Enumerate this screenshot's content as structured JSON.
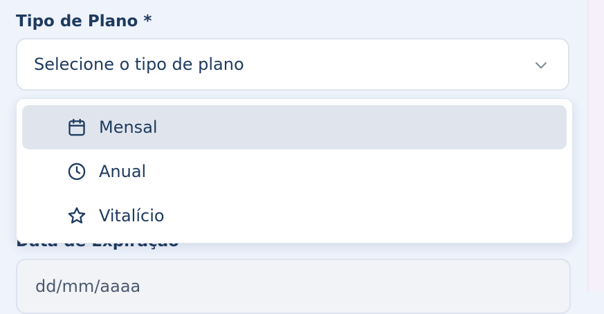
{
  "form": {
    "plan_type": {
      "label": "Tipo de Plano *",
      "placeholder": "Selecione o tipo de plano",
      "options": [
        {
          "label": "Mensal",
          "icon": "calendar-icon",
          "highlighted": true
        },
        {
          "label": "Anual",
          "icon": "clock-icon",
          "highlighted": false
        },
        {
          "label": "Vitalício",
          "icon": "star-icon",
          "highlighted": false
        }
      ]
    },
    "expiration": {
      "label": "Data de Expiração",
      "placeholder": "dd/mm/aaaa"
    }
  },
  "colors": {
    "text": "#1e3a5f",
    "highlight": "#e0e5ed",
    "page_background": "#eef3fc"
  }
}
